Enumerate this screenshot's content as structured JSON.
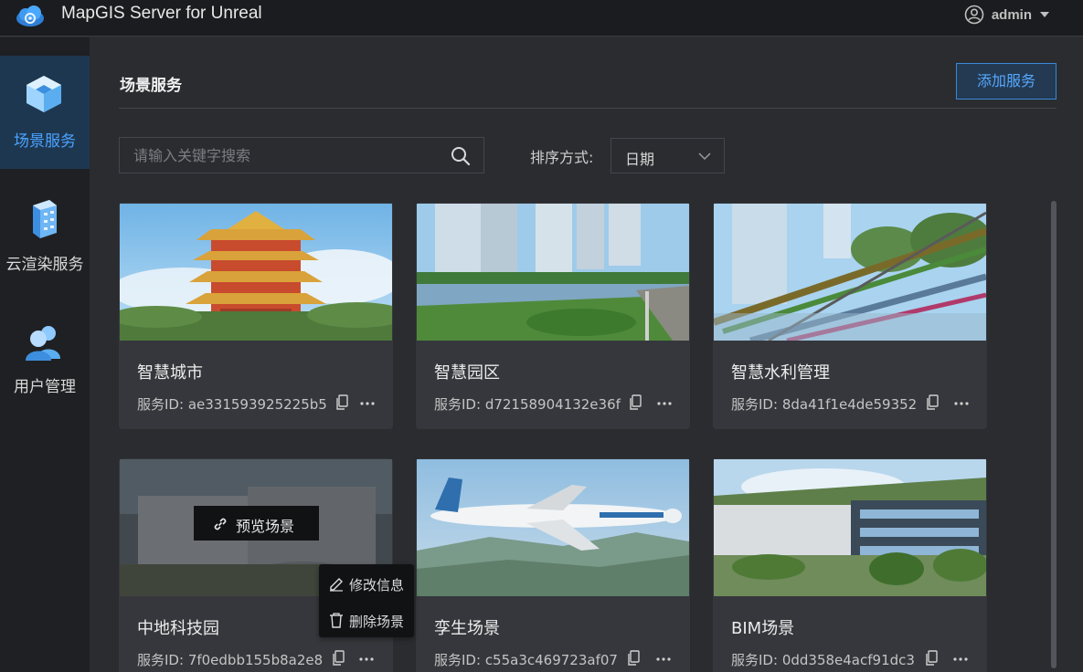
{
  "app": {
    "title": "MapGIS Server for Unreal",
    "logo_icon": "cloud-logo-icon"
  },
  "user": {
    "name": "admin",
    "icon": "user-circle-icon",
    "menu_icon": "caret-down-icon"
  },
  "sidebar": {
    "items": [
      {
        "label": "场景服务",
        "icon": "cube-icon",
        "active": true
      },
      {
        "label": "云渲染服务",
        "icon": "server-icon",
        "active": false
      },
      {
        "label": "用户管理",
        "icon": "users-icon",
        "active": false
      }
    ]
  },
  "main": {
    "title": "场景服务",
    "add_button": "添加服务",
    "search": {
      "placeholder": "请输入关键字搜索",
      "value": ""
    },
    "sort": {
      "label": "排序方式:",
      "selected": "日期"
    }
  },
  "cards": [
    {
      "title": "智慧城市",
      "id_label": "服务ID:",
      "id": "ae331593925225b5",
      "thumb": "pagoda-tower"
    },
    {
      "title": "智慧园区",
      "id_label": "服务ID:",
      "id": "d72158904132e36f",
      "thumb": "park-lake"
    },
    {
      "title": "智慧水利管理",
      "id_label": "服务ID:",
      "id": "8da41f1e4de59352",
      "thumb": "pipelines"
    },
    {
      "title": "中地科技园",
      "id_label": "服务ID:",
      "id": "7f0edbb155b8a2e8",
      "thumb": "tech-campus"
    },
    {
      "title": "孪生场景",
      "id_label": "服务ID:",
      "id": "c55a3c469723af07",
      "thumb": "airplane"
    },
    {
      "title": "BIM场景",
      "id_label": "服务ID:",
      "id": "0dd358e4acf91dc3",
      "thumb": "bim-building"
    }
  ],
  "hover": {
    "preview_label": "预览场景"
  },
  "card_menu": {
    "edit_label": "修改信息",
    "delete_label": "删除场景"
  },
  "colors": {
    "accent": "#4aa3ff",
    "active_bg": "#1e3750",
    "card_bg": "#36373c",
    "page_bg": "#2b2c30"
  }
}
